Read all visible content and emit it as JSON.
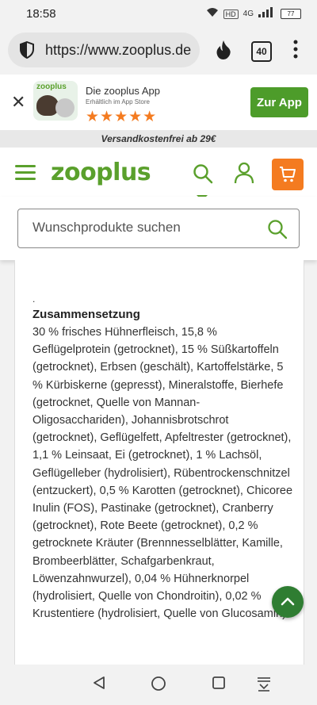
{
  "status_bar": {
    "time": "18:58",
    "network_badge": "HD",
    "network_label": "4G",
    "battery": "77"
  },
  "browser": {
    "url": "https://www.zooplus.de",
    "tab_count": "40"
  },
  "app_banner": {
    "logo_text": "zooplus",
    "title": "Die zooplus App",
    "subtitle": "Erhältlich im App Store",
    "rating_stars": "★★★★★",
    "cta": "Zur App"
  },
  "shipping_notice": "Versandkostenfrei ab 29€",
  "header": {
    "logo": "zooplus"
  },
  "search": {
    "placeholder": "Wunschprodukte suchen"
  },
  "product": {
    "dot": ".",
    "section_title": "Zusammensetzung",
    "composition": "30 % frisches Hühnerfleisch, 15,8 % Geflügelprotein (getrocknet), 15 % Süßkartoffeln (getrocknet), Erbsen (geschält), Kartoffelstärke, 5 % Kürbiskerne (gepresst), Mineralstoffe, Bierhefe (getrocknet, Quelle von Mannan-Oligosacchariden), Johannisbrotschrot (getrocknet), Geflügelfett, Apfeltrester (getrocknet), 1,1 % Leinsaat, Ei (getrocknet), 1 % Lachsöl, Geflügelleber (hydrolisiert), Rübentrockenschnitzel (entzuckert), 0,5 % Karotten (getrocknet), Chicoree Inulin (FOS), Pastinake (getrocknet), Cranberry (getrocknet), Rote Beete (getrocknet), 0,2 % getrocknete Kräuter (Brennnesselblätter, Kamille, Brombeerblätter, Schafgarbenkraut, Löwenzahnwurzel), 0,04 % Hühnerknorpel (hydrolisiert, Quelle von Chondroitin), 0,02 % Krustentiere (hydrolisiert, Quelle von Glucosamin)."
  },
  "colors": {
    "brand_green": "#5aa02c",
    "cart_orange": "#f47b20",
    "fab_green": "#2f7d32"
  },
  "icons": [
    "wifi-icon",
    "signal-icon",
    "shield-icon",
    "flame-icon",
    "more-vert-icon",
    "close-icon",
    "hamburger-icon",
    "search-icon",
    "user-icon",
    "cart-icon",
    "chevron-up-icon",
    "back-icon",
    "home-icon",
    "recents-icon",
    "keyboard-hide-icon"
  ]
}
